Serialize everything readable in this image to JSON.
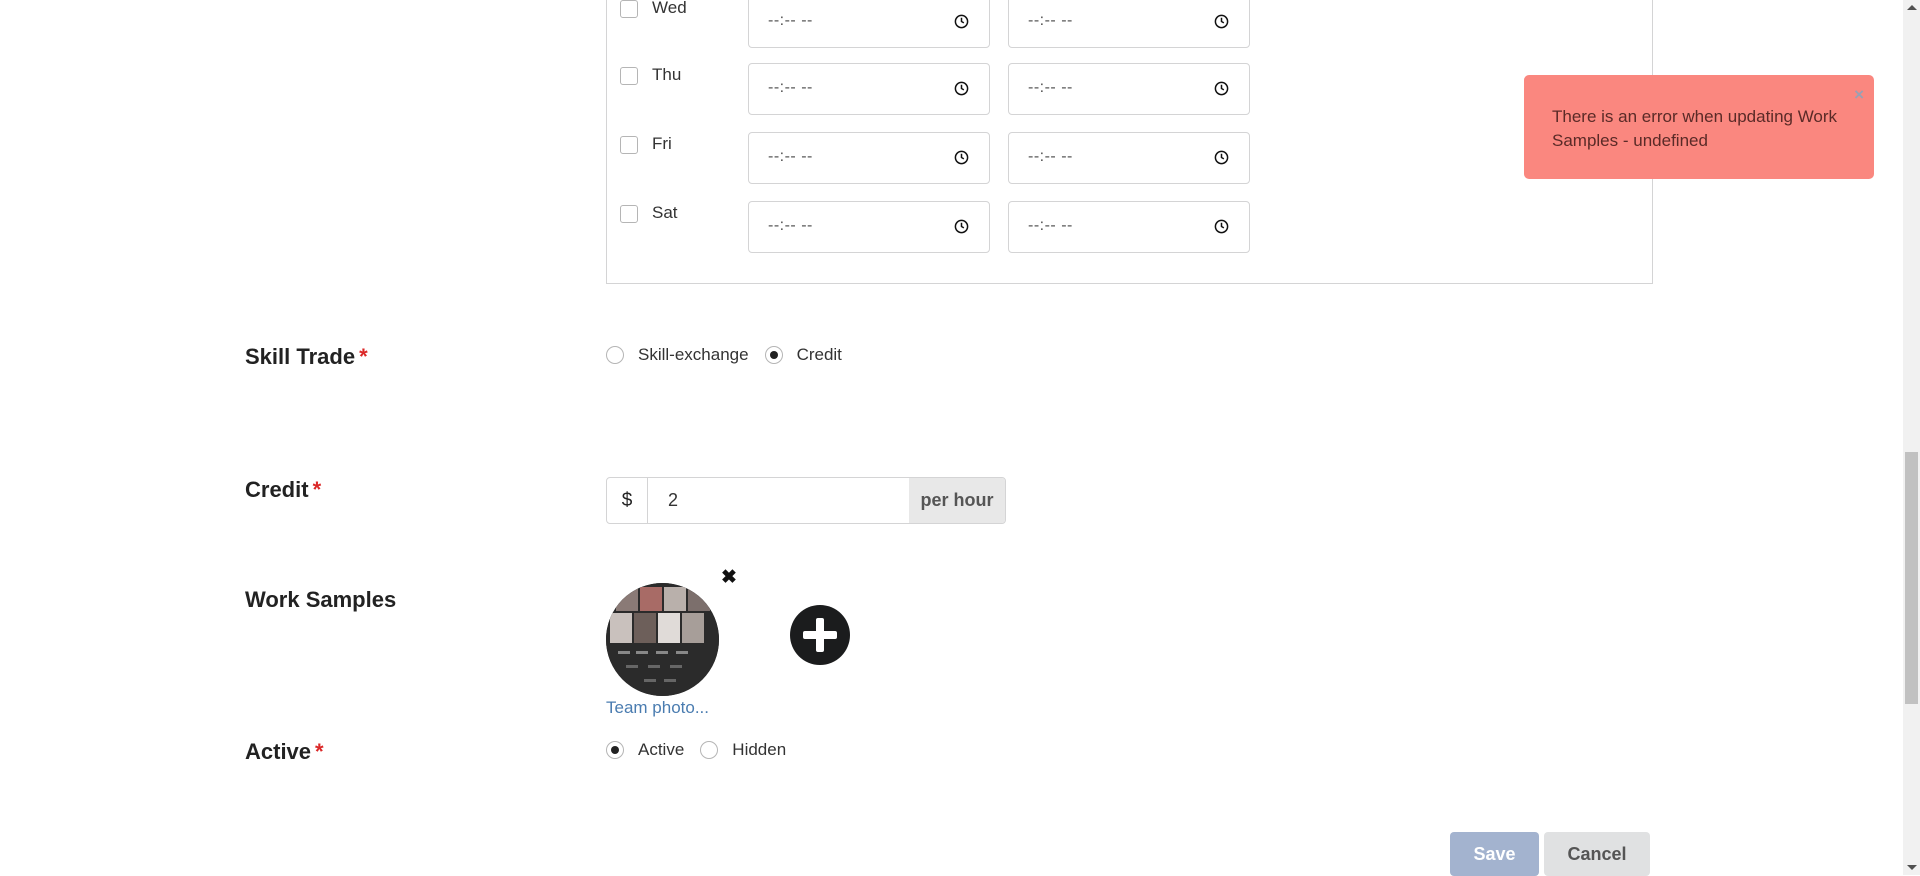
{
  "availability": {
    "days": [
      {
        "label": "Wed",
        "start": "--:-- --",
        "end": "--:-- --"
      },
      {
        "label": "Thu",
        "start": "--:-- --",
        "end": "--:-- --"
      },
      {
        "label": "Fri",
        "start": "--:-- --",
        "end": "--:-- --"
      },
      {
        "label": "Sat",
        "start": "--:-- --",
        "end": "--:-- --"
      }
    ]
  },
  "skill_trade": {
    "label": "Skill Trade",
    "required_mark": "*",
    "options": [
      {
        "label": "Skill-exchange",
        "selected": false
      },
      {
        "label": "Credit",
        "selected": true
      }
    ]
  },
  "credit": {
    "label": "Credit",
    "required_mark": "*",
    "prefix": "$",
    "value": "2",
    "suffix": "per hour"
  },
  "work_samples": {
    "label": "Work Samples",
    "items": [
      {
        "caption": "Team photo...",
        "remove_icon": "close-icon"
      }
    ],
    "add_icon": "plus-circle-icon"
  },
  "active": {
    "label": "Active",
    "required_mark": "*",
    "options": [
      {
        "label": "Active",
        "selected": true
      },
      {
        "label": "Hidden",
        "selected": false
      }
    ]
  },
  "actions": {
    "save": "Save",
    "cancel": "Cancel"
  },
  "toast": {
    "message": "There is an error when updating Work Samples - undefined",
    "close": "×",
    "color": "#fa877f"
  }
}
